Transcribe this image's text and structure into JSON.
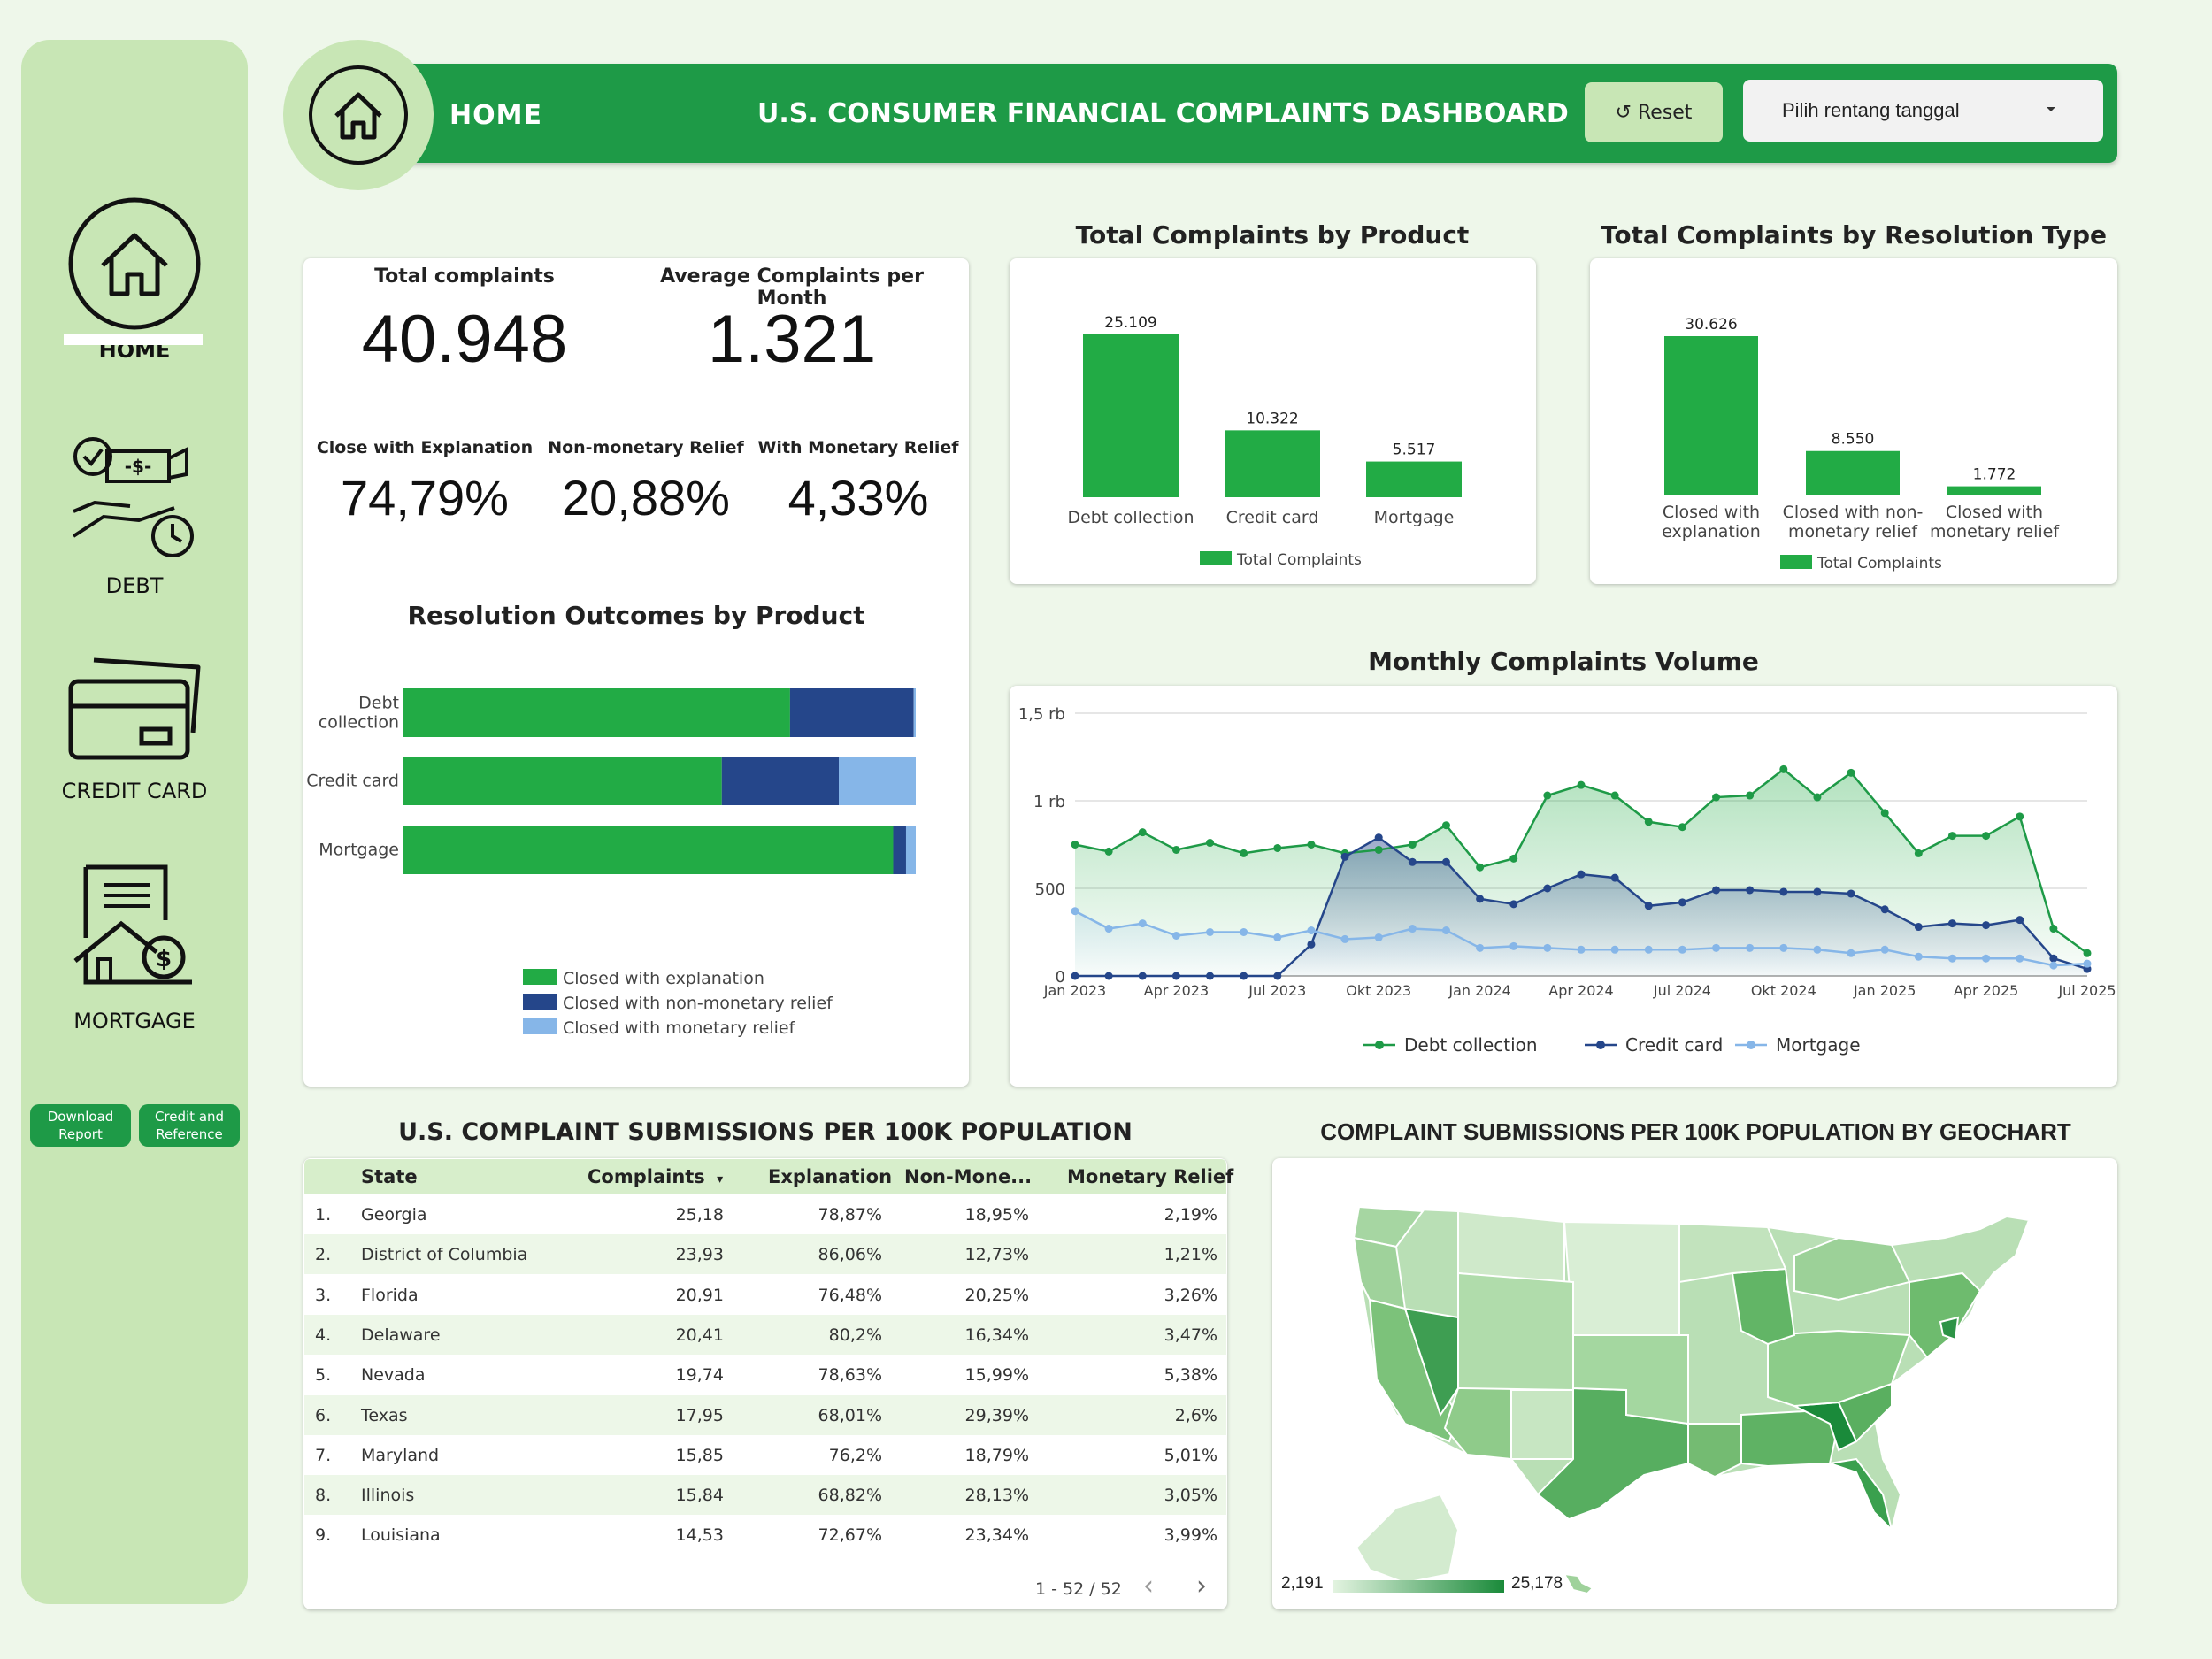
{
  "sidebar": {
    "home_label": "HOME",
    "debt_label": "DEBT",
    "credit_card_label": "CREDIT CARD",
    "mortgage_label": "MORTGAGE",
    "download_label": "Download Report",
    "credit_ref_label": "Credit and Reference"
  },
  "header": {
    "home": "HOME",
    "title": "U.S. CONSUMER FINANCIAL COMPLAINTS DASHBOARD",
    "reset": "↺ Reset",
    "date_placeholder": "Pilih rentang tanggal"
  },
  "kpis": {
    "total_label": "Total complaints",
    "total_value": "40.948",
    "avg_label": "Average Complaints per Month",
    "avg_value": "1.321",
    "close_expl_label": "Close with Explanation",
    "close_expl_value": "74,79%",
    "nonmon_label": "Non-monetary Relief",
    "nonmon_value": "20,88%",
    "mon_label": "With Monetary Relief",
    "mon_value": "4,33%"
  },
  "colors": {
    "green": "#22ab45",
    "navy": "#25468a",
    "light_blue": "#86b6e8",
    "header_green": "#1e9a47",
    "sidebar_green": "#c8e6b5",
    "page_bg": "#eef7ea"
  },
  "chart_data": [
    {
      "id": "product",
      "type": "bar",
      "title": "Total Complaints by Product",
      "categories": [
        [
          "Debt collection"
        ],
        [
          "Credit card"
        ],
        [
          "Mortgage"
        ]
      ],
      "values": [
        25109,
        10322,
        5517
      ],
      "labels": [
        "25.109",
        "10.322",
        "5.517"
      ],
      "legend": "Total Complaints"
    },
    {
      "id": "resolution",
      "type": "bar",
      "title": "Total Complaints by Resolution Type",
      "categories": [
        [
          "Closed with",
          "explanation"
        ],
        [
          "Closed with non-",
          "monetary relief"
        ],
        [
          "Closed with",
          "monetary relief"
        ]
      ],
      "values": [
        30626,
        8550,
        1772
      ],
      "labels": [
        "30.626",
        "8.550",
        "1.772"
      ],
      "legend": "Total Complaints"
    },
    {
      "id": "outcomes",
      "type": "bar",
      "orientation": "horizontal-stacked-100",
      "title": "Resolution Outcomes by Product",
      "categories": [
        [
          "Debt",
          "collection"
        ],
        [
          "Credit card"
        ],
        [
          "Mortgage"
        ]
      ],
      "series": [
        {
          "name": "Closed with explanation",
          "values": [
            75.5,
            62.2,
            95.6
          ]
        },
        {
          "name": "Closed with non-monetary relief",
          "values": [
            24.1,
            22.8,
            2.5
          ]
        },
        {
          "name": "Closed with monetary relief",
          "values": [
            0.4,
            15.0,
            1.9
          ]
        }
      ]
    },
    {
      "id": "monthly",
      "type": "line",
      "title": "Monthly Complaints Volume",
      "x_tick_labels": [
        "Jan 2023",
        "Apr 2023",
        "Jul 2023",
        "Okt 2023",
        "Jan 2024",
        "Apr 2024",
        "Jul 2024",
        "Okt 2024",
        "Jan 2025",
        "Apr 2025",
        "Jul 2025"
      ],
      "y_tick_labels": [
        "0",
        "500",
        "1 rb",
        "1,5 rb"
      ],
      "ylim": [
        0,
        1500
      ],
      "series": [
        {
          "name": "Debt collection",
          "values": [
            750,
            710,
            820,
            720,
            760,
            700,
            730,
            750,
            700,
            720,
            750,
            860,
            620,
            670,
            1030,
            1090,
            1030,
            880,
            850,
            1020,
            1030,
            1180,
            1020,
            1160,
            930,
            700,
            800,
            800,
            910,
            270,
            130
          ]
        },
        {
          "name": "Credit card",
          "values": [
            0,
            0,
            0,
            0,
            0,
            0,
            0,
            180,
            680,
            790,
            650,
            650,
            440,
            410,
            500,
            580,
            560,
            400,
            420,
            490,
            490,
            480,
            480,
            470,
            380,
            280,
            300,
            290,
            320,
            100,
            40
          ]
        },
        {
          "name": "Mortgage",
          "values": [
            370,
            270,
            300,
            230,
            250,
            250,
            220,
            260,
            210,
            220,
            270,
            260,
            160,
            170,
            160,
            150,
            150,
            150,
            150,
            160,
            160,
            160,
            150,
            130,
            150,
            110,
            100,
            100,
            100,
            60,
            70
          ]
        }
      ]
    }
  ],
  "table": {
    "title": "U.S. COMPLAINT SUBMISSIONS PER 100K POPULATION",
    "headers": [
      "State",
      "Complaints",
      "Explanation",
      "Non-Mone...",
      "Monetary Relief"
    ],
    "sort_icon": "▾",
    "rows": [
      [
        "1.",
        "Georgia",
        "25,18",
        "78,87%",
        "18,95%",
        "2,19%"
      ],
      [
        "2.",
        "District of Columbia",
        "23,93",
        "86,06%",
        "12,73%",
        "1,21%"
      ],
      [
        "3.",
        "Florida",
        "20,91",
        "76,48%",
        "20,25%",
        "3,26%"
      ],
      [
        "4.",
        "Delaware",
        "20,41",
        "80,2%",
        "16,34%",
        "3,47%"
      ],
      [
        "5.",
        "Nevada",
        "19,74",
        "78,63%",
        "15,99%",
        "5,38%"
      ],
      [
        "6.",
        "Texas",
        "17,95",
        "68,01%",
        "29,39%",
        "2,6%"
      ],
      [
        "7.",
        "Maryland",
        "15,85",
        "76,2%",
        "18,79%",
        "5,01%"
      ],
      [
        "8.",
        "Illinois",
        "15,84",
        "68,82%",
        "28,13%",
        "3,05%"
      ],
      [
        "9.",
        "Louisiana",
        "14,53",
        "72,67%",
        "23,34%",
        "3,99%"
      ]
    ],
    "pagination": "1 - 52 / 52"
  },
  "geo": {
    "title": "COMPLAINT SUBMISSIONS PER 100K POPULATION BY GEOCHART",
    "min_label": "2,191",
    "max_label": "25,178"
  }
}
